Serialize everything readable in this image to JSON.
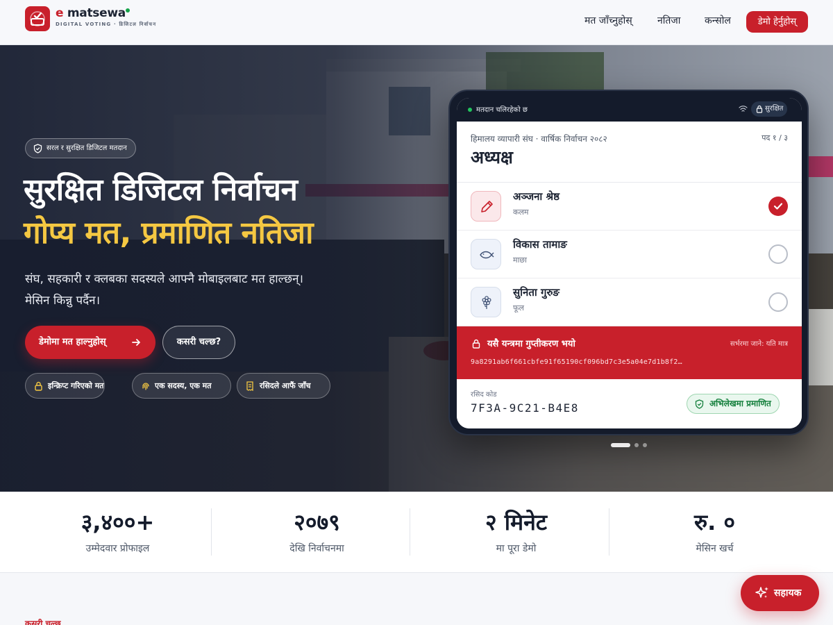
{
  "brand": {
    "name_prefix": "e",
    "name": " matsewa",
    "subtitle": "DIGITAL VOTING · डिजिटल निर्वाचन",
    "accent": "#c8202b"
  },
  "nav": {
    "links": [
      "मत जाँच्नुहोस्",
      "नतिजा",
      "कन्सोल"
    ],
    "cta": "डेमो हेर्नुहोस्"
  },
  "hero": {
    "badge": "सरल र सुरक्षित डिजिटल मतदान",
    "title_line1": "सुरक्षित डिजिटल निर्वाचन",
    "title_line2": "गोप्य मत, प्रमाणित नतिजा",
    "lead": "संघ, सहकारी र क्लबका सदस्यले आफ्नै मोबाइलबाट मत हाल्छन्। मेसिन किन्नु पर्दैन।",
    "primary_button": "डेमोमा मत हाल्नुहोस्",
    "secondary_button": "कसरी चल्छ?",
    "chips": [
      "इन्क्रिप्ट गरिएको मत",
      "एक सदस्य, एक मत",
      "रसिदले आफैं जाँच"
    ],
    "highlight_color": "#f5c842"
  },
  "ballot": {
    "status": "मतदान चलिरहेको छ",
    "secure": "सुरक्षित",
    "org": "हिमालय व्यापारी संघ · वार्षिक निर्वाचन २०८२",
    "position_counter": "पद १ / ३",
    "position_title": "अध्यक्ष",
    "candidates": [
      {
        "name": "अञ्जना श्रेष्ठ",
        "symbol": "कलम",
        "icon": "pen-icon",
        "selected": true
      },
      {
        "name": "विकास तामाङ",
        "symbol": "माछा",
        "icon": "fish-icon",
        "selected": false
      },
      {
        "name": "सुनिता गुरुङ",
        "symbol": "फूल",
        "icon": "flower-icon",
        "selected": false
      }
    ],
    "encrypted_title": "यसै यन्त्रमा गुप्तीकरण भयो",
    "encrypted_note": "सर्भरमा जाने: यति मात्र",
    "hash": "9a8291ab6f661cbfe91f65190cf096bd7c3e5a04e7d1b8f2…",
    "receipt_label": "रसिद कोड",
    "receipt_code": "7F3A-9C21-B4E8",
    "verified": "अभिलेखमा प्रमाणित"
  },
  "stats": [
    {
      "value": "३,४००+",
      "label": "उम्मेदवार प्रोफाइल"
    },
    {
      "value": "२०७९",
      "label": "देखि निर्वाचनमा"
    },
    {
      "value": "२ मिनेट",
      "label": "मा पूरा डेमो"
    },
    {
      "value": "रु. ०",
      "label": "मेसिन खर्च"
    }
  ],
  "section_kicker": "कसरी चल्छ",
  "assistant_button": "सहायक"
}
